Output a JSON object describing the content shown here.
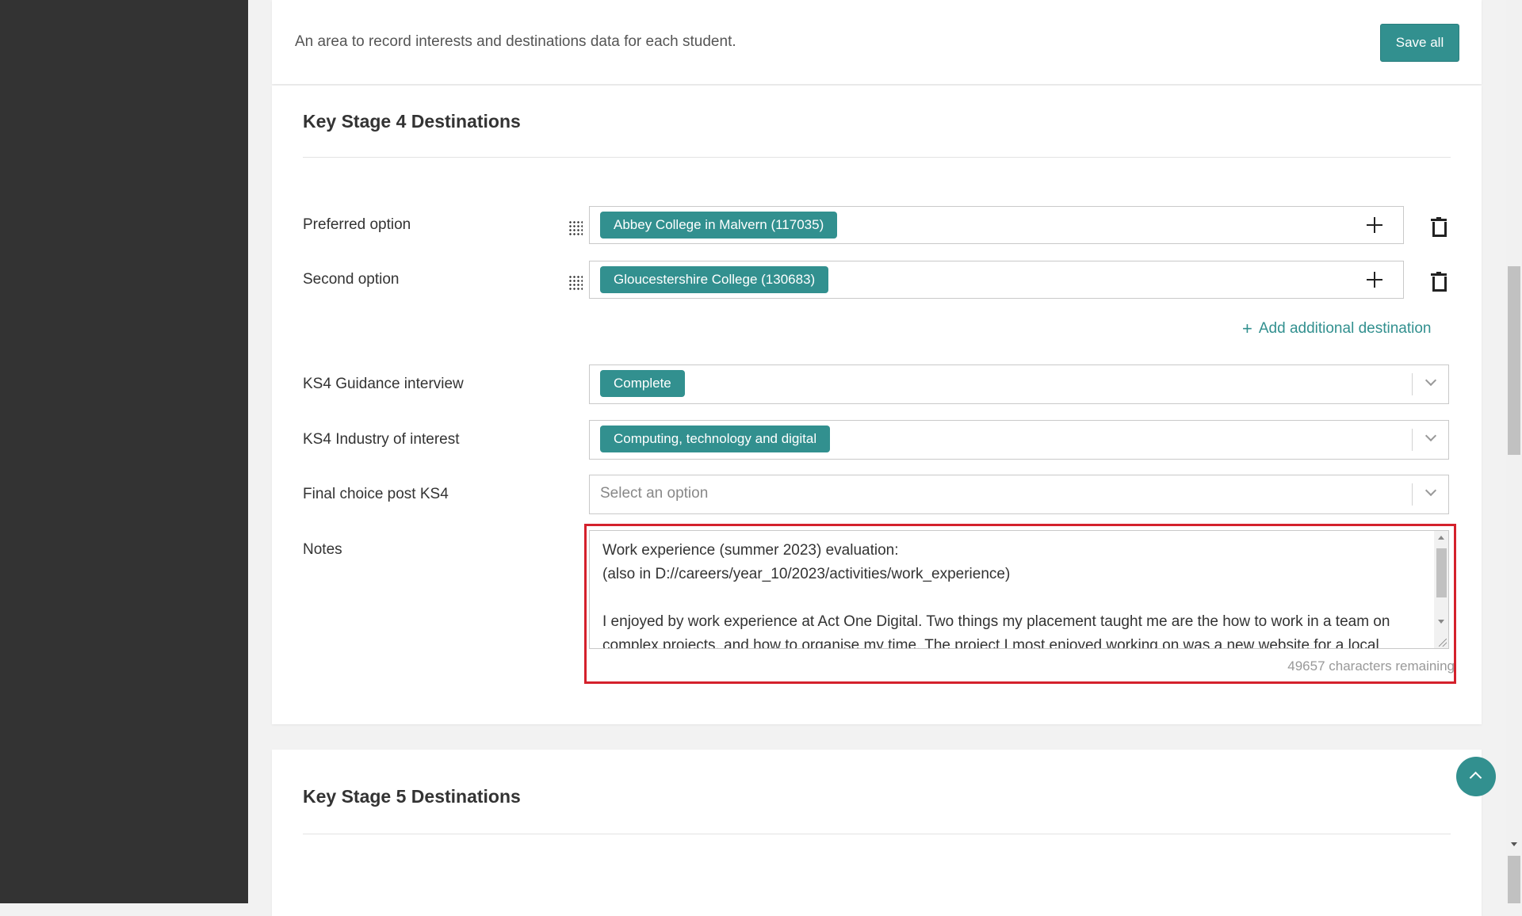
{
  "header": {
    "description": "An area to record interests and destinations data for each student.",
    "save_label": "Save all"
  },
  "ks4": {
    "title": "Key Stage 4 Destinations",
    "preferred": {
      "label": "Preferred option",
      "value": "Abbey College in Malvern (117035)"
    },
    "second": {
      "label": "Second option",
      "value": "Gloucestershire College (130683)"
    },
    "add_destination_label": "Add additional destination",
    "guidance": {
      "label": "KS4 Guidance interview",
      "value": "Complete"
    },
    "industry": {
      "label": "KS4 Industry of interest",
      "value": "Computing, technology and digital"
    },
    "final_choice": {
      "label": "Final choice post KS4",
      "placeholder": "Select an option"
    },
    "notes": {
      "label": "Notes",
      "text": "Work experience (summer 2023) evaluation:\n(also in D://careers/year_10/2023/activities/work_experience)\n\nI enjoyed by work experience at Act One Digital. Two things my placement taught me are the how to work in a team on complex projects, and how to organise my time. The project I most enjoyed working on was a new website for a local",
      "chars_remaining": "49657 characters remaining"
    }
  },
  "ks5": {
    "title": "Key Stage 5 Destinations"
  },
  "colors": {
    "accent": "#32908f",
    "highlight": "#d4212c",
    "sidebar": "#333333"
  }
}
